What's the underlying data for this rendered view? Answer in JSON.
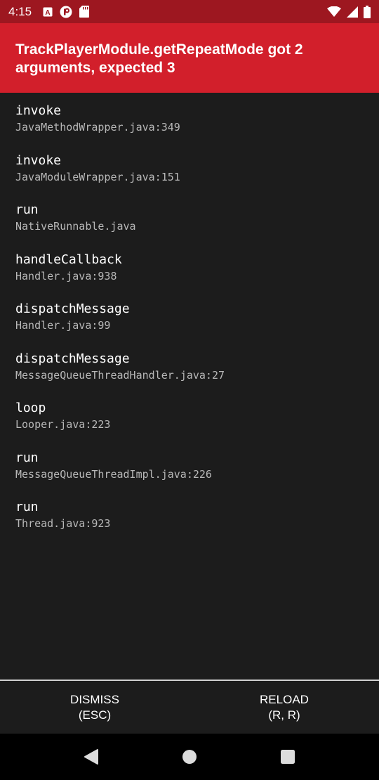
{
  "status_bar": {
    "time": "4:15",
    "left_icons": [
      "a-box-icon",
      "pocket-icon",
      "sd-card-icon"
    ],
    "right_icons": [
      "wifi-icon",
      "signal-icon",
      "battery-icon"
    ]
  },
  "error": {
    "title": "TrackPlayerModule.getRepeatMode got 2 arguments, expected 3",
    "header_color": "#d21f2b"
  },
  "stack": [
    {
      "method": "invoke",
      "file": "JavaMethodWrapper.java:349"
    },
    {
      "method": "invoke",
      "file": "JavaModuleWrapper.java:151"
    },
    {
      "method": "run",
      "file": "NativeRunnable.java"
    },
    {
      "method": "handleCallback",
      "file": "Handler.java:938"
    },
    {
      "method": "dispatchMessage",
      "file": "Handler.java:99"
    },
    {
      "method": "dispatchMessage",
      "file": "MessageQueueThreadHandler.java:27"
    },
    {
      "method": "loop",
      "file": "Looper.java:223"
    },
    {
      "method": "run",
      "file": "MessageQueueThreadImpl.java:226"
    },
    {
      "method": "run",
      "file": "Thread.java:923"
    }
  ],
  "footer": {
    "dismiss_line1": "DISMISS",
    "dismiss_line2": "(ESC)",
    "reload_line1": "RELOAD",
    "reload_line2": "(R, R)"
  },
  "nav": {
    "icons": [
      "back-triangle-icon",
      "home-circle-icon",
      "recents-square-icon"
    ]
  }
}
